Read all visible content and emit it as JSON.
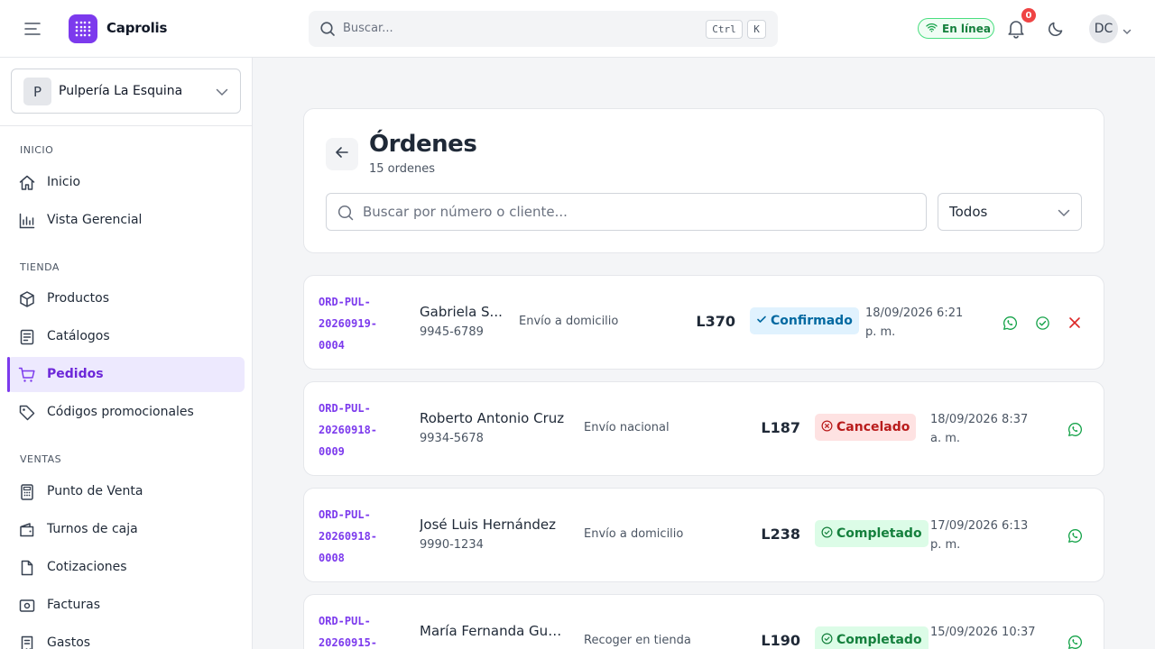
{
  "app": {
    "brand": "Caprolis",
    "search_placeholder": "Buscar...",
    "kbd_ctrl": "Ctrl",
    "kbd_k": "K",
    "status": "En línea",
    "notifications_count": "0",
    "user_initials": "DC"
  },
  "sidebar": {
    "store": {
      "initial": "P",
      "name": "Pulpería La Esquina"
    },
    "sections": [
      {
        "label": "INICIO",
        "items": [
          {
            "label": "Inicio",
            "icon": "home-icon"
          },
          {
            "label": "Vista Gerencial",
            "icon": "bar-chart-icon"
          }
        ]
      },
      {
        "label": "TIENDA",
        "items": [
          {
            "label": "Productos",
            "icon": "box-icon"
          },
          {
            "label": "Catálogos",
            "icon": "book-icon"
          },
          {
            "label": "Pedidos",
            "icon": "cart-icon",
            "active": true
          },
          {
            "label": "Códigos promocionales",
            "icon": "tag-icon"
          }
        ]
      },
      {
        "label": "VENTAS",
        "items": [
          {
            "label": "Punto de Venta",
            "icon": "calculator-icon"
          },
          {
            "label": "Turnos de caja",
            "icon": "wallet-icon"
          },
          {
            "label": "Cotizaciones",
            "icon": "document-icon"
          },
          {
            "label": "Facturas",
            "icon": "receipt-icon"
          },
          {
            "label": "Gastos",
            "icon": "expense-icon"
          }
        ]
      }
    ]
  },
  "main": {
    "title": "Órdenes",
    "subtitle": "15 ordenes",
    "search_placeholder": "Buscar por número o cliente...",
    "filter_value": "Todos",
    "orders": [
      {
        "number_lines": [
          "ORD-PUL-",
          "20260919-",
          "0004"
        ],
        "customer": "Gabriela S...",
        "phone": "9945-6789",
        "shipping": "Envío a domicilio",
        "total": "L370",
        "status": "Confirmado",
        "status_kind": "confirmed",
        "date_lines": [
          "18/09/2026 6:21",
          "p. m."
        ],
        "actions": [
          "whatsapp",
          "confirm",
          "cancel"
        ]
      },
      {
        "number_lines": [
          "ORD-PUL-",
          "20260918-",
          "0009"
        ],
        "customer": "Roberto Antonio Cruz",
        "phone": "9934-5678",
        "shipping": "Envío nacional",
        "total": "L187",
        "status": "Cancelado",
        "status_kind": "cancelled",
        "date_lines": [
          "18/09/2026 8:37",
          "a. m."
        ],
        "actions": [
          "whatsapp"
        ]
      },
      {
        "number_lines": [
          "ORD-PUL-",
          "20260918-",
          "0008"
        ],
        "customer": "José Luis Hernández",
        "phone": "9990-1234",
        "shipping": "Envío a domicilio",
        "total": "L238",
        "status": "Completado",
        "status_kind": "completed",
        "date_lines": [
          "17/09/2026 6:13",
          "p. m."
        ],
        "actions": [
          "whatsapp"
        ]
      },
      {
        "number_lines": [
          "ORD-PUL-",
          "20260915-",
          ""
        ],
        "customer": "María Fernanda Guti...",
        "phone": "",
        "shipping": "Recoger en tienda",
        "total": "L190",
        "status": "Completado",
        "status_kind": "completed",
        "date_lines": [
          "15/09/2026 10:37",
          ""
        ],
        "actions": [
          "whatsapp"
        ]
      }
    ]
  }
}
